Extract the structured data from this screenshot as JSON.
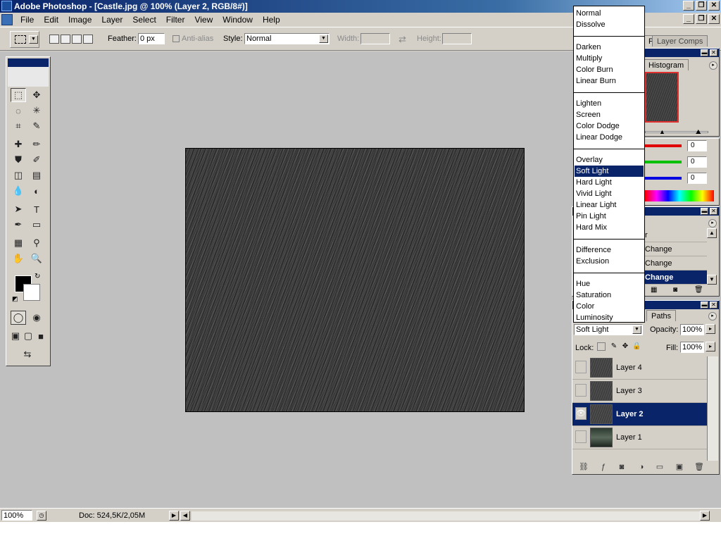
{
  "window": {
    "title": "Adobe Photoshop - [Castle.jpg @ 100% (Layer 2, RGB/8#)]",
    "minimize_glyph": "_",
    "restore_glyph": "❐",
    "close_glyph": "✕"
  },
  "menubar": {
    "items": [
      "File",
      "Edit",
      "Image",
      "Layer",
      "Select",
      "Filter",
      "View",
      "Window",
      "Help"
    ]
  },
  "options": {
    "feather_label": "Feather:",
    "feather_value": "0 px",
    "antialias_label": "Anti-alias",
    "style_label": "Style:",
    "style_value": "Normal",
    "width_label": "Width:",
    "height_label": "Height:",
    "swap_glyph": "⇄"
  },
  "panels": {
    "top_tabs": [
      "Pr",
      "Layer Comps"
    ],
    "histogram_tab": "Histogram",
    "color_values": [
      "0",
      "0",
      "0"
    ],
    "colors": {
      "red": "#e00000",
      "green": "#00c000",
      "blue": "#0000e0"
    },
    "history_rows": [
      "r",
      "Change",
      "Change",
      "Change"
    ],
    "history_selected_index": 3,
    "paths_tab": "Paths"
  },
  "layers": {
    "blend_mode": "Soft Light",
    "opacity_label": "Opacity:",
    "opacity_value": "100%",
    "lock_label": "Lock:",
    "fill_label": "Fill:",
    "fill_value": "100%",
    "eye_glyph": "👁",
    "items": [
      {
        "name": "Layer 4",
        "visible": false,
        "selected": false,
        "thumb": "rain"
      },
      {
        "name": "Layer 3",
        "visible": false,
        "selected": false,
        "thumb": "rain"
      },
      {
        "name": "Layer 2",
        "visible": true,
        "selected": true,
        "thumb": "rain"
      },
      {
        "name": "Layer 1",
        "visible": false,
        "selected": false,
        "thumb": "photo"
      }
    ]
  },
  "blend_menu": {
    "groups": [
      [
        "Normal",
        "Dissolve"
      ],
      [
        "Darken",
        "Multiply",
        "Color Burn",
        "Linear Burn"
      ],
      [
        "Lighten",
        "Screen",
        "Color Dodge",
        "Linear Dodge"
      ],
      [
        "Overlay",
        "Soft Light",
        "Hard Light",
        "Vivid Light",
        "Linear Light",
        "Pin Light",
        "Hard Mix"
      ],
      [
        "Difference",
        "Exclusion"
      ],
      [
        "Hue",
        "Saturation",
        "Color",
        "Luminosity"
      ]
    ],
    "selected": "Soft Light"
  },
  "status": {
    "zoom": "100%",
    "doc": "Doc: 524,5K/2,05M"
  },
  "accent_color": "#0a246a"
}
